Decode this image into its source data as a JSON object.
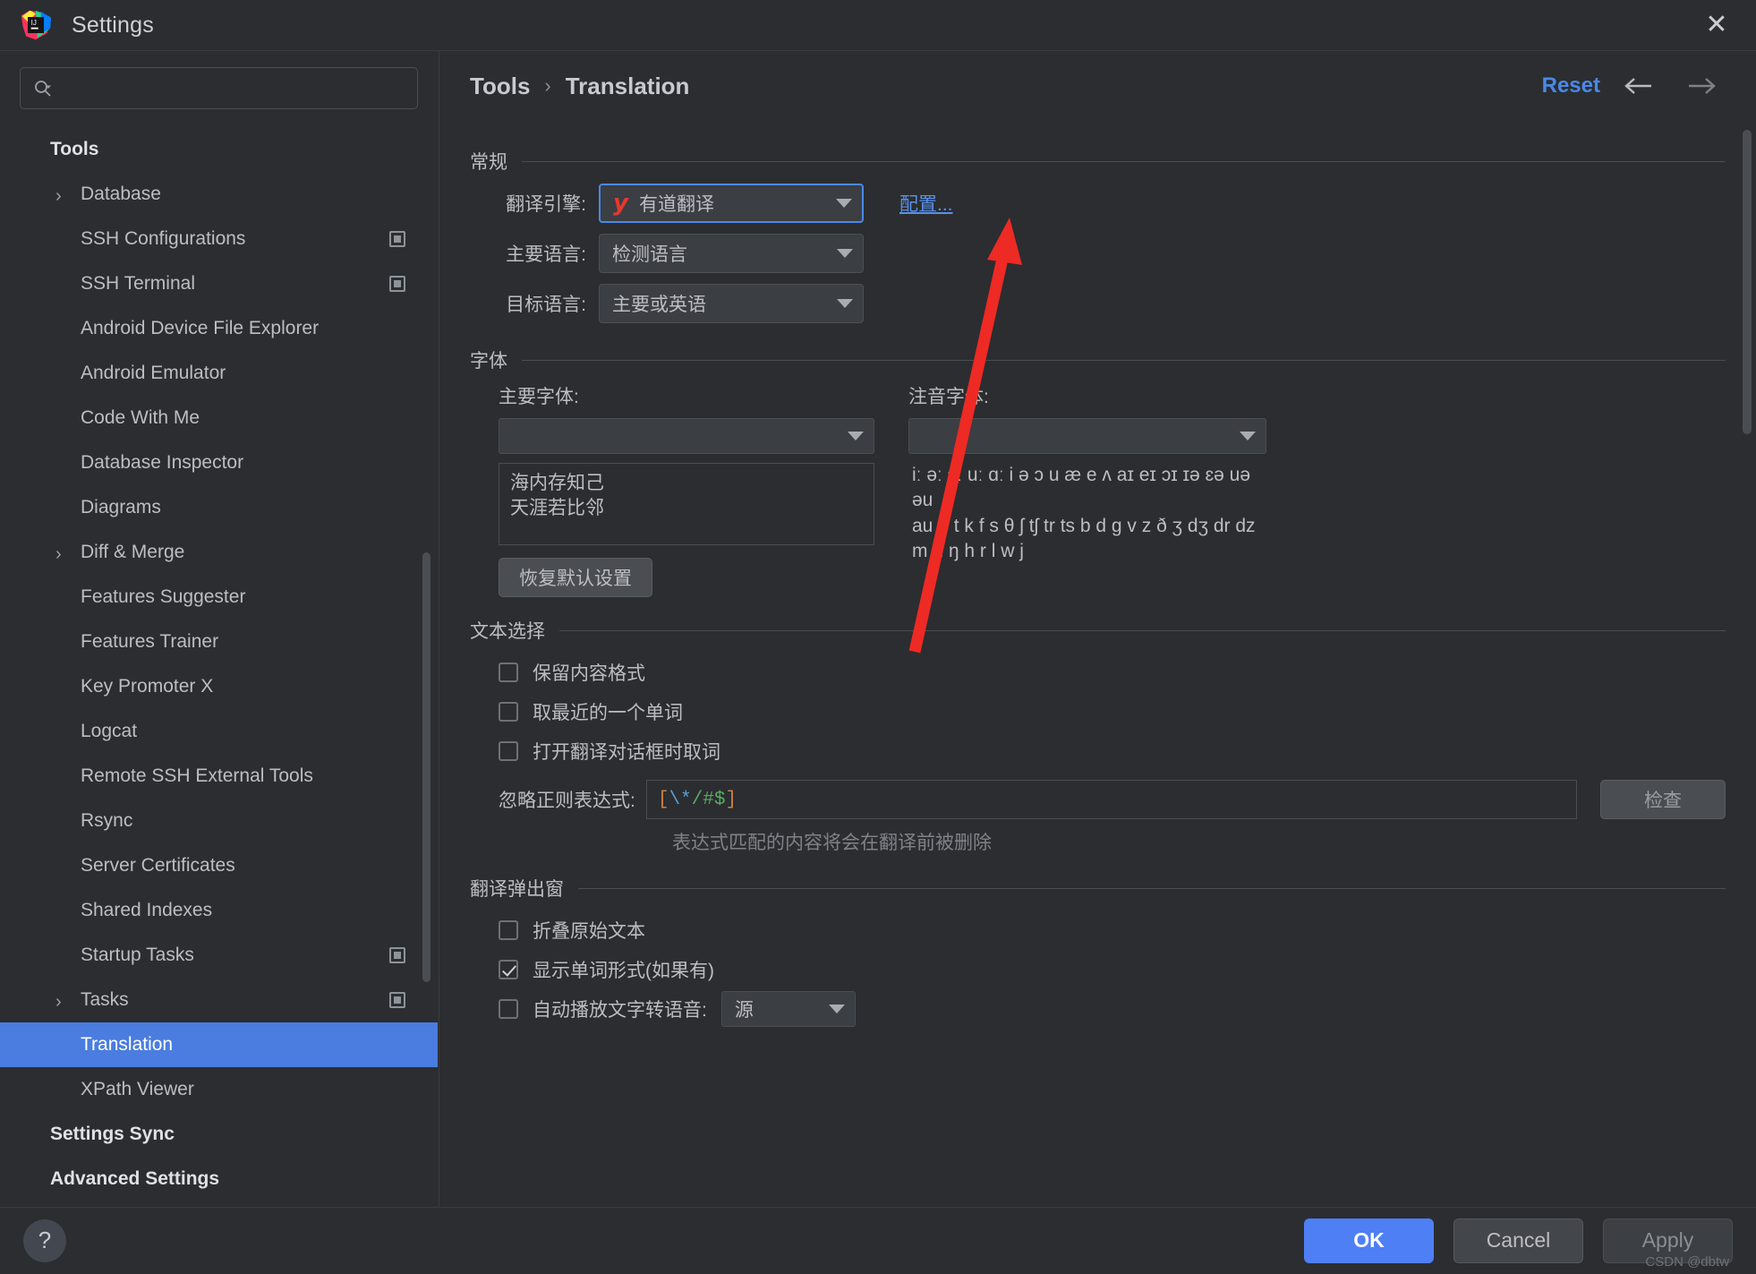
{
  "window": {
    "title": "Settings",
    "logo_icon": "intellij-idea-logo",
    "close_icon": "close-icon"
  },
  "search": {
    "placeholder": "",
    "value": "",
    "icon": "search-icon"
  },
  "sidebar": {
    "items": [
      {
        "label": "Tools",
        "type": "group",
        "twisty": false,
        "badge": false,
        "selected": false
      },
      {
        "label": "Database",
        "type": "child",
        "twisty": true,
        "badge": false,
        "selected": false
      },
      {
        "label": "SSH Configurations",
        "type": "child",
        "twisty": false,
        "badge": true,
        "selected": false
      },
      {
        "label": "SSH Terminal",
        "type": "child",
        "twisty": false,
        "badge": true,
        "selected": false
      },
      {
        "label": "Android Device File Explorer",
        "type": "child",
        "twisty": false,
        "badge": false,
        "selected": false
      },
      {
        "label": "Android Emulator",
        "type": "child",
        "twisty": false,
        "badge": false,
        "selected": false
      },
      {
        "label": "Code With Me",
        "type": "child",
        "twisty": false,
        "badge": false,
        "selected": false
      },
      {
        "label": "Database Inspector",
        "type": "child",
        "twisty": false,
        "badge": false,
        "selected": false
      },
      {
        "label": "Diagrams",
        "type": "child",
        "twisty": false,
        "badge": false,
        "selected": false
      },
      {
        "label": "Diff & Merge",
        "type": "child",
        "twisty": true,
        "badge": false,
        "selected": false
      },
      {
        "label": "Features Suggester",
        "type": "child",
        "twisty": false,
        "badge": false,
        "selected": false
      },
      {
        "label": "Features Trainer",
        "type": "child",
        "twisty": false,
        "badge": false,
        "selected": false
      },
      {
        "label": "Key Promoter X",
        "type": "child",
        "twisty": false,
        "badge": false,
        "selected": false
      },
      {
        "label": "Logcat",
        "type": "child",
        "twisty": false,
        "badge": false,
        "selected": false
      },
      {
        "label": "Remote SSH External Tools",
        "type": "child",
        "twisty": false,
        "badge": false,
        "selected": false
      },
      {
        "label": "Rsync",
        "type": "child",
        "twisty": false,
        "badge": false,
        "selected": false
      },
      {
        "label": "Server Certificates",
        "type": "child",
        "twisty": false,
        "badge": false,
        "selected": false
      },
      {
        "label": "Shared Indexes",
        "type": "child",
        "twisty": false,
        "badge": false,
        "selected": false
      },
      {
        "label": "Startup Tasks",
        "type": "child",
        "twisty": false,
        "badge": true,
        "selected": false
      },
      {
        "label": "Tasks",
        "type": "child",
        "twisty": true,
        "badge": true,
        "selected": false
      },
      {
        "label": "Translation",
        "type": "child",
        "twisty": false,
        "badge": false,
        "selected": true
      },
      {
        "label": "XPath Viewer",
        "type": "child",
        "twisty": false,
        "badge": false,
        "selected": false
      },
      {
        "label": "Settings Sync",
        "type": "group",
        "twisty": false,
        "badge": false,
        "selected": false
      },
      {
        "label": "Advanced Settings",
        "type": "group",
        "twisty": false,
        "badge": false,
        "selected": false
      }
    ]
  },
  "breadcrumb": {
    "parent": "Tools",
    "separator": "›",
    "current": "Translation"
  },
  "toolbar": {
    "reset_label": "Reset",
    "back_icon": "arrow-left-icon",
    "forward_icon": "arrow-right-icon"
  },
  "general": {
    "section_title": "常规",
    "engine_label": "翻译引擎:",
    "engine_value": "有道翻译",
    "engine_logo": "youdao-logo",
    "configure_link": "配置...",
    "primary_lang_label": "主要语言:",
    "primary_lang_value": "检测语言",
    "target_lang_label": "目标语言:",
    "target_lang_value": "主要或英语"
  },
  "font": {
    "section_title": "字体",
    "primary_font_label": "主要字体:",
    "primary_font_value": "",
    "phonetic_font_label": "注音字体:",
    "phonetic_font_value": "",
    "preview_line1": "海内存知己",
    "preview_line2": "天涯若比邻",
    "ipa_line1": "iː əː ɔː uː ɑː i ə ɔ u æ e ʌ aɪ eɪ ɔɪ ɪə ɛə uə əu",
    "ipa_line2": "au p t k f s θ ʃ tʃ tr ts b d g v z ð ʒ dʒ dr dz",
    "ipa_line3": "m n ŋ h r l w j",
    "restore_button": "恢复默认设置"
  },
  "text_selection": {
    "section_title": "文本选择",
    "checkboxes": [
      {
        "label": "保留内容格式",
        "checked": false
      },
      {
        "label": "取最近的一个单词",
        "checked": false
      },
      {
        "label": "打开翻译对话框时取词",
        "checked": false
      }
    ],
    "regex_label": "忽略正则表达式:",
    "regex_value": "[\\*/#$]",
    "regex_parts": {
      "open": "[",
      "escape": "\\*",
      "mid": "/#",
      "dollar": "$",
      "close": "]"
    },
    "check_button": "检查",
    "hint": "表达式匹配的内容将会在翻译前被删除"
  },
  "popup": {
    "section_title": "翻译弹出窗",
    "checkboxes": [
      {
        "label": "折叠原始文本",
        "checked": false
      },
      {
        "label": "显示单词形式(如果有)",
        "checked": true
      }
    ],
    "tts_label": "自动播放文字转语音:",
    "tts_checked": false,
    "tts_value": "源"
  },
  "footer": {
    "help_icon": "help-icon",
    "ok_label": "OK",
    "cancel_label": "Cancel",
    "apply_label": "Apply",
    "watermark": "CSDN @dbtw"
  },
  "colors": {
    "accent_blue": "#4f7ff5",
    "link_blue": "#4a88e8",
    "selection_blue": "#4a7ddf",
    "annotation_red": "#ee2a24",
    "youdao_red": "#e8382f",
    "background": "#2b2d30"
  }
}
